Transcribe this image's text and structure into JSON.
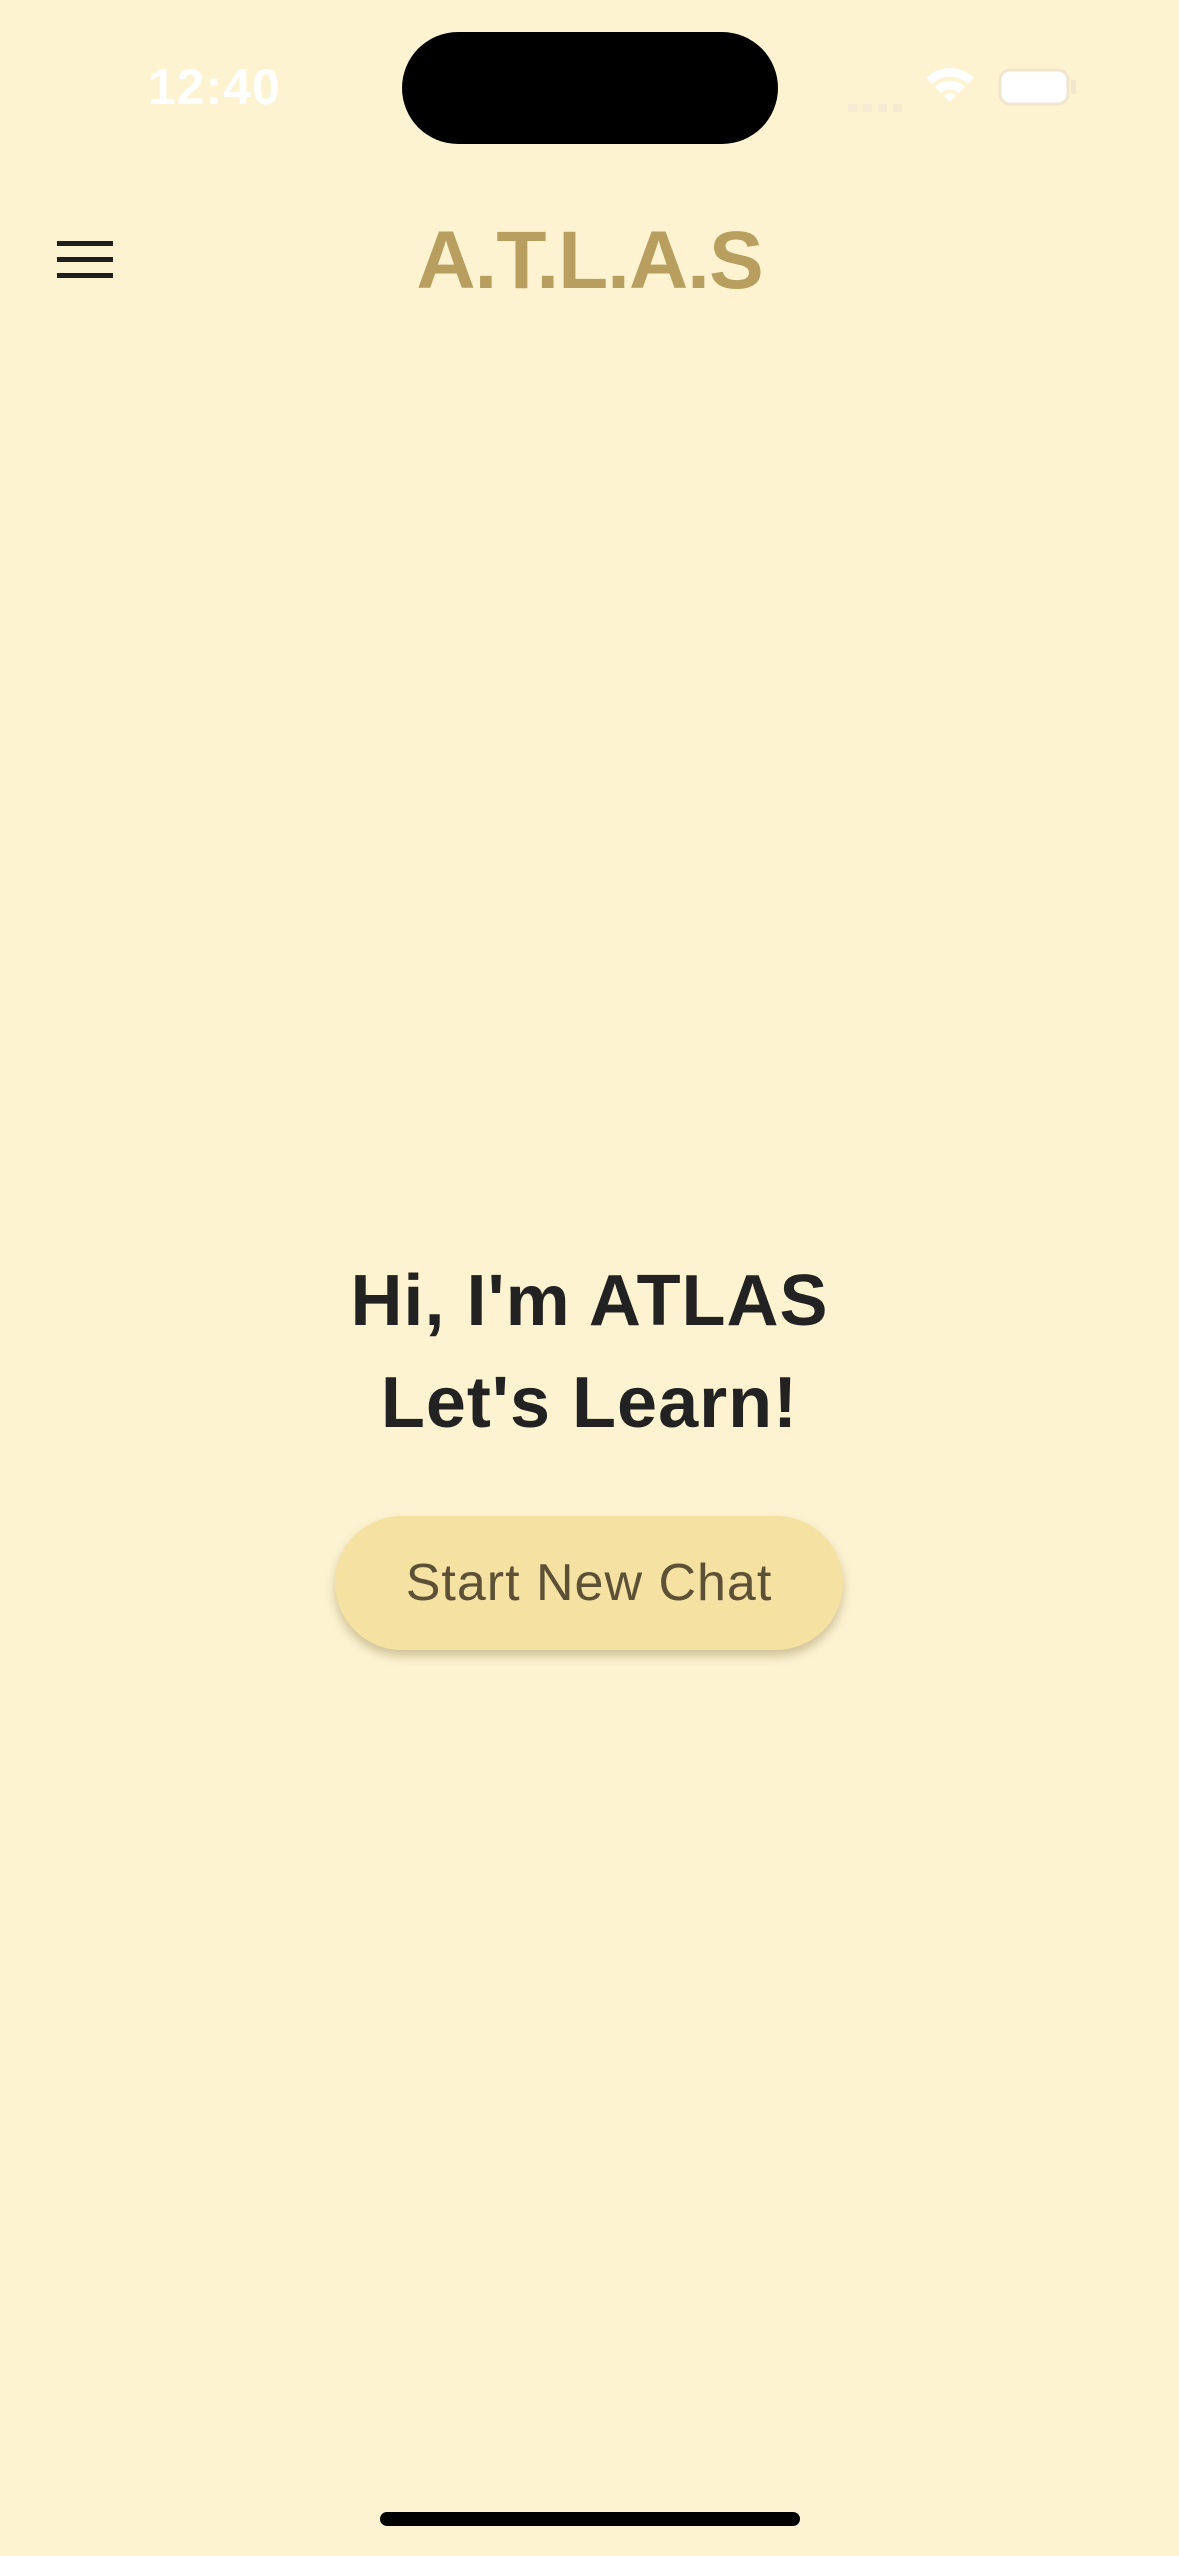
{
  "status_bar": {
    "time": "12:40",
    "icons": [
      "cellular-signal-icon",
      "wifi-icon",
      "battery-icon"
    ]
  },
  "header": {
    "menu_icon": "hamburger-menu-icon",
    "title": "A.T.L.A.S"
  },
  "main": {
    "greeting_line1": "Hi, I'm ATLAS",
    "greeting_line2": "Let's Learn!",
    "start_button_label": "Start New Chat"
  },
  "colors": {
    "background": "#fdf3d1",
    "title": "#b89f5f",
    "button_background": "#f5e1a2",
    "button_text": "#5c5136",
    "text_primary": "#222222"
  }
}
